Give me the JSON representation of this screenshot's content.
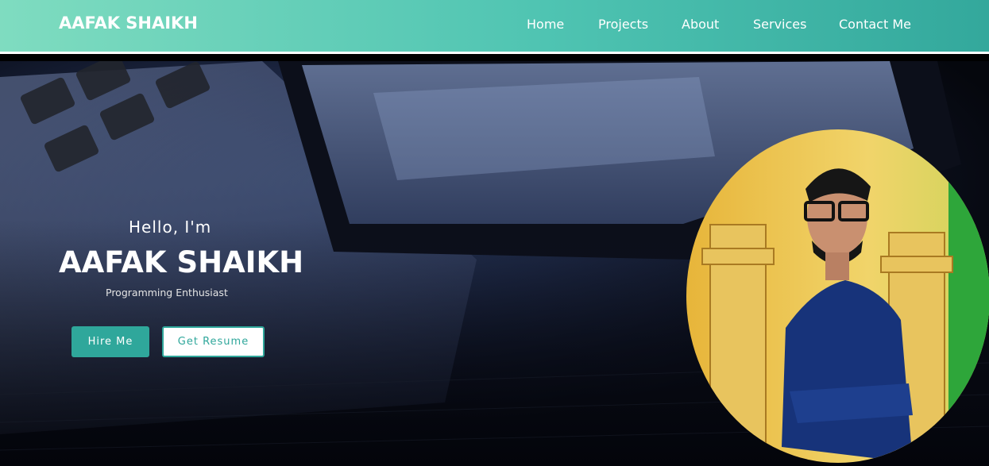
{
  "header": {
    "brand": "AAFAK SHAIKH",
    "nav": [
      "Home",
      "Projects",
      "About",
      "Services",
      "Contact Me"
    ]
  },
  "hero": {
    "greeting": "Hello, I'm",
    "name": "AAFAK SHAIKH",
    "tagline": "Programming Enthusiast",
    "buttons": {
      "hire": "Hire Me",
      "resume": "Get Resume"
    }
  },
  "colors": {
    "nav_gradient_start": "#7fdcc0",
    "nav_gradient_end": "#33a89c",
    "accent": "#2fa79b"
  },
  "icons": {
    "profile_photo": "profile-photo"
  }
}
